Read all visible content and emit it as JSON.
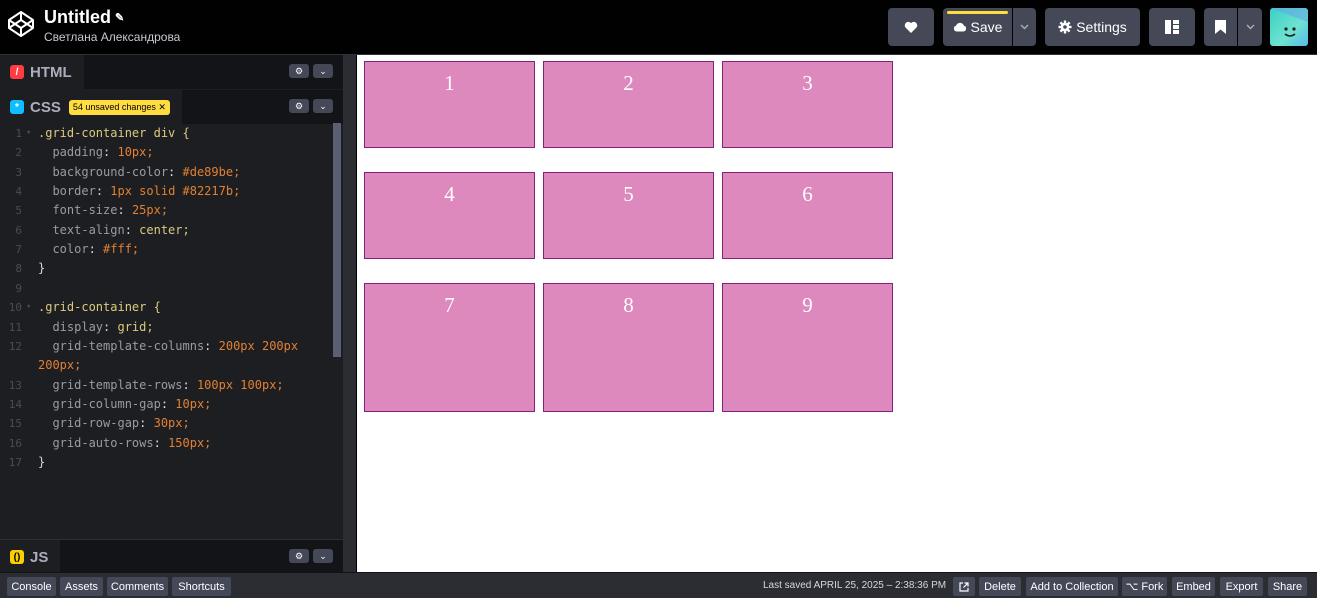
{
  "header": {
    "title": "Untitled",
    "author": "Светлана Александрова",
    "save_label": "Save",
    "settings_label": "Settings"
  },
  "editors": {
    "html_label": "HTML",
    "css_label": "CSS",
    "js_label": "JS",
    "unsaved_label": "54 unsaved changes"
  },
  "code_lines": [
    {
      "n": "1",
      "fold": true
    },
    {
      "n": "2"
    },
    {
      "n": "3"
    },
    {
      "n": "4"
    },
    {
      "n": "5"
    },
    {
      "n": "6"
    },
    {
      "n": "7"
    },
    {
      "n": "8"
    },
    {
      "n": "9"
    },
    {
      "n": "10",
      "fold": true
    },
    {
      "n": "11"
    },
    {
      "n": "12"
    },
    {
      "n": ""
    },
    {
      "n": "13"
    },
    {
      "n": "14"
    },
    {
      "n": "15"
    },
    {
      "n": "16"
    },
    {
      "n": "17"
    }
  ],
  "code_text": [
    ".grid-container div {",
    "  padding: 10px;",
    "  background-color: #de89be;",
    "  border: 1px solid #82217b;",
    "  font-size: 25px;",
    "  text-align: center;",
    "  color: #fff;",
    "}",
    "",
    ".grid-container {",
    "  display: grid;",
    "  grid-template-columns: 200px 200px",
    "200px;",
    "  grid-template-rows: 100px 100px;",
    "  grid-column-gap: 10px;",
    "  grid-row-gap: 30px;",
    "  grid-auto-rows: 150px;",
    "}"
  ],
  "preview": {
    "cells": [
      "1",
      "2",
      "3",
      "4",
      "5",
      "6",
      "7",
      "8",
      "9"
    ],
    "cell_color": "#de89be",
    "border_color": "#82217b"
  },
  "footer": {
    "console": "Console",
    "assets": "Assets",
    "comments": "Comments",
    "shortcuts": "Shortcuts",
    "last_saved": "Last saved APRIL 25, 2025 – 2:38:36 PM",
    "delete": "Delete",
    "add_to_collection": "Add to Collection",
    "fork": "Fork",
    "embed": "Embed",
    "export": "Export",
    "share": "Share"
  },
  "colors": {
    "accent": "#ffdd40",
    "html_badge": "#ff3c41",
    "css_badge": "#0ebeff",
    "js_badge": "#fcd000"
  }
}
